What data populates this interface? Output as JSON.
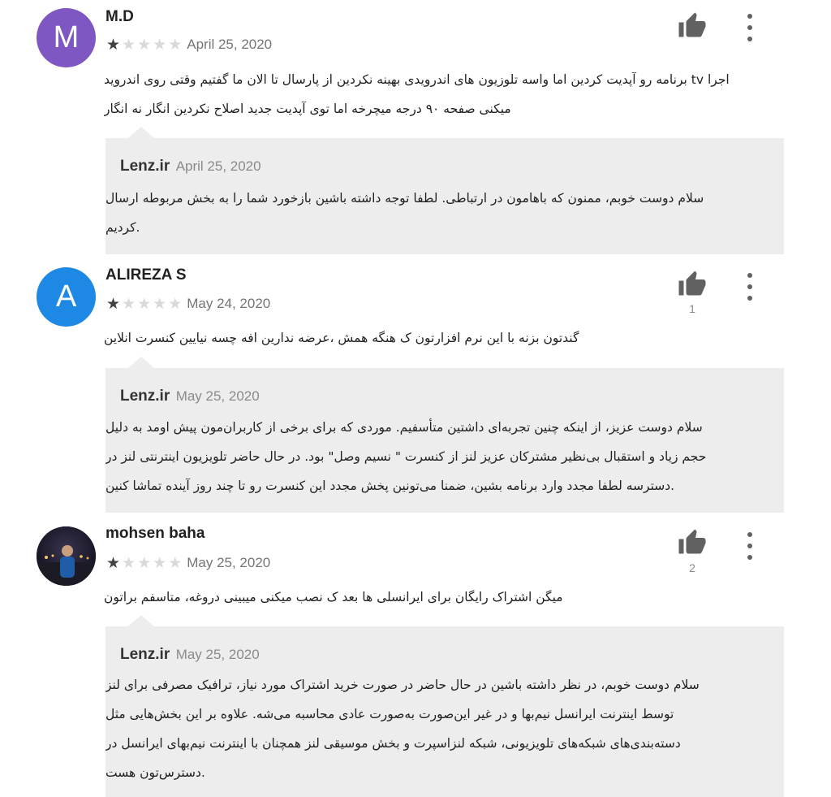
{
  "reviews": [
    {
      "author": "M.D",
      "avatar_letter": "M",
      "avatar_color": "#7e57c2",
      "rating": 1,
      "date": "April 25, 2020",
      "text_lines": [
        "اجرا tv برنامه رو آپدیت کردین اما واسه تلوزیون های اندرویدی بهینه نکردین از پارسال تا الان ما گفتیم وقتی روی اندروید",
        "میکنی صفحه ۹۰ درجه میچرخه اما توی آپدیت جدید اصلاح نکردین انگار نه انگار"
      ],
      "helpful_count": "",
      "reply": {
        "developer": "Lenz.ir",
        "date": "April 25, 2020",
        "text_lines": [
          "سلام دوست خوبم، ممنون که باهامون در ارتباطی. لطفا توجه داشته باشین بازخورد شما را به بخش مربوطه ارسال",
          ".کردیم"
        ]
      }
    },
    {
      "author": "ALIREZA S",
      "avatar_letter": "A",
      "avatar_color": "#1e88e5",
      "rating": 1,
      "date": "May 24, 2020",
      "text_lines": [
        "گندتون بزنه با این نرم افزارتون ک هنگه همش ،عرضه ندارین افه چسه نیایین کنسرت انلاین"
      ],
      "helpful_count": "1",
      "reply": {
        "developer": "Lenz.ir",
        "date": "May 25, 2020",
        "text_lines": [
          "سلام دوست عزیز، از اینکه چنین تجربه‌ای داشتین متأسفیم. موردی که برای برخی از کاربران‌مون پیش اومد به دلیل",
          "حجم زیاد و استقبال بی‌نظیر مشترکان عزیز لنز از کنسرت \" نسیم وصل\" بود. در حال حاضر تلویزیون اینترنتی لنز در",
          ".دسترسه لطفا مجدد وارد برنامه بشین، ضمنا می‌تونین پخش مجدد این کنسرت رو تا چند روز آینده تماشا کنین"
        ]
      }
    },
    {
      "author": "mohsen baha",
      "avatar_letter": "",
      "avatar_color": "#1a1a2e",
      "rating": 1,
      "date": "May 25, 2020",
      "text_lines": [
        "میگن اشتراک رایگان برای ایرانسلی ها بعد ک نصب میکنی میبینی دروغه، متاسفم براتون"
      ],
      "helpful_count": "2",
      "reply": {
        "developer": "Lenz.ir",
        "date": "May 25, 2020",
        "text_lines": [
          "سلام دوست خوبم، در نظر داشته باشین در حال حاضر در صورت خرید اشتراک مورد نیاز، ترافیک مصرفی برای لنز",
          "توسط اینترنت ایرانسل نیم‌بها و در غیر این‌صورت به‌صورت عادی محاسبه می‌شه. علاوه بر این بخش‌هایی مثل",
          "دسته‌بندی‌های شبکه‌های تلویزیونی، شبکه لنزاسپرت و بخش موسیقی لنز همچنان با اینترنت نیم‌بهای ایرانسل در",
          ".دسترس‌تون هست"
        ]
      }
    }
  ],
  "icons": {
    "thumb": "thumbs-up-icon",
    "more": "more-vert-icon",
    "star": "star-icon"
  },
  "colors": {
    "reply_bg": "#ededed",
    "star_on": "#424242",
    "star_off": "#d9d9d9"
  }
}
